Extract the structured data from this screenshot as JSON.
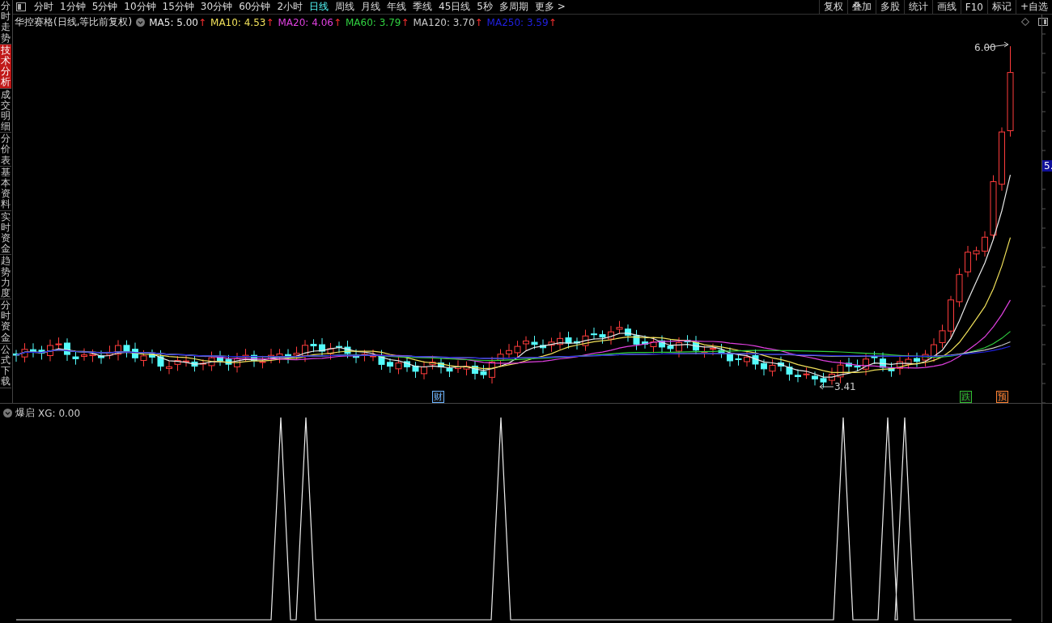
{
  "sidebar": {
    "tabs": [
      {
        "label": "分时走势",
        "selected": false
      },
      {
        "label": "技术分析",
        "selected": true
      },
      {
        "label": "成交明细",
        "selected": false
      },
      {
        "label": "分价表",
        "selected": false
      },
      {
        "label": "基本资料",
        "selected": false
      },
      {
        "label": "实时资金",
        "selected": false
      },
      {
        "label": "趋势力度",
        "selected": false
      },
      {
        "label": "分时资金",
        "selected": false
      },
      {
        "label": "公式下载",
        "selected": false
      }
    ]
  },
  "period_tabs": [
    {
      "label": "分时",
      "selected": false
    },
    {
      "label": "1分钟",
      "selected": false
    },
    {
      "label": "5分钟",
      "selected": false
    },
    {
      "label": "10分钟",
      "selected": false
    },
    {
      "label": "15分钟",
      "selected": false
    },
    {
      "label": "30分钟",
      "selected": false
    },
    {
      "label": "60分钟",
      "selected": false
    },
    {
      "label": "2小时",
      "selected": false
    },
    {
      "label": "日线",
      "selected": true
    },
    {
      "label": "周线",
      "selected": false
    },
    {
      "label": "月线",
      "selected": false
    },
    {
      "label": "年线",
      "selected": false
    },
    {
      "label": "季线",
      "selected": false
    },
    {
      "label": "45日线",
      "selected": false
    },
    {
      "label": "5秒",
      "selected": false
    },
    {
      "label": "多周期",
      "selected": false
    },
    {
      "label": "更多 >",
      "selected": false
    }
  ],
  "tool_buttons": [
    "复权",
    "叠加",
    "多股",
    "统计",
    "画线",
    "F10",
    "标记",
    "+自选"
  ],
  "price_panel": {
    "title": "华控赛格(日线,等比前复权)",
    "moving_averages": [
      {
        "label": "MA5: 5.00",
        "trend": "↑",
        "color": "#e8e8e8"
      },
      {
        "label": "MA10: 4.53",
        "trend": "↑",
        "color": "#f0e05a"
      },
      {
        "label": "MA20: 4.06",
        "trend": "↑",
        "color": "#e040e0"
      },
      {
        "label": "MA60: 3.79",
        "trend": "↑",
        "color": "#30d040"
      },
      {
        "label": "MA120: 3.70",
        "trend": "↑",
        "color": "#c8c8c8"
      },
      {
        "label": "MA250: 3.59",
        "trend": "↑",
        "color": "#2020e0"
      }
    ],
    "high_label": "6.00",
    "low_label": "3.41",
    "axis_tag": "5.",
    "markers": [
      {
        "text": "财",
        "color": "#6cb4ff"
      },
      {
        "text": "跌",
        "color": "#30c030"
      },
      {
        "text": "预",
        "color": "#ff8030"
      }
    ]
  },
  "indicator_panel": {
    "name": "爆启",
    "reading": "XG: 0.00"
  }
}
